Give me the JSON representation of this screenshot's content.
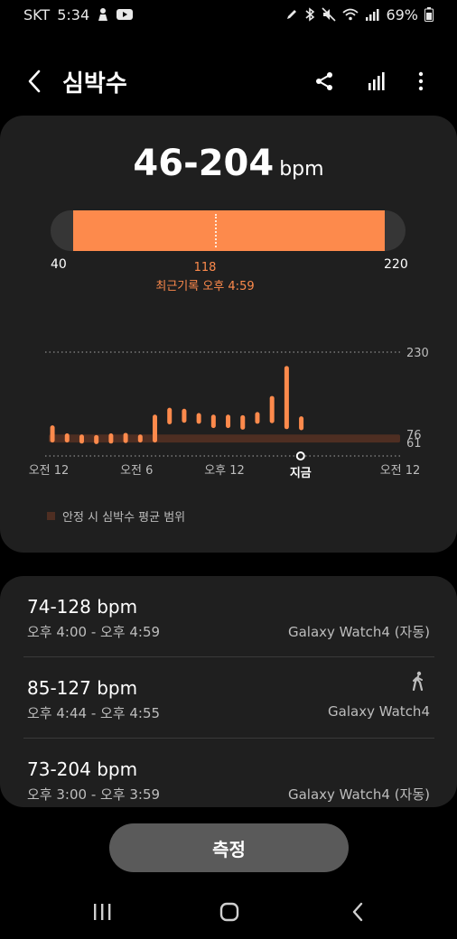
{
  "status_bar": {
    "carrier": "SKT",
    "time": "5:34",
    "battery": "69%",
    "icons": [
      "person-notification-icon",
      "youtube-icon",
      "pen-icon",
      "bluetooth-icon",
      "mute-icon",
      "wifi-icon",
      "signal-icon",
      "battery-icon"
    ]
  },
  "header": {
    "title": "심박수",
    "actions": [
      "share-icon",
      "chart-icon",
      "more-icon"
    ]
  },
  "summary": {
    "range": "46-204",
    "unit": "bpm",
    "scale_min": "40",
    "scale_max": "220",
    "current_value": "118",
    "current_label": "최근기록 오후 4:59",
    "fill_from_bpm": 46,
    "fill_to_bpm": 204,
    "marker_bpm": 118
  },
  "chart_data": {
    "type": "bar",
    "y_ticks": [
      "230",
      "76",
      "61"
    ],
    "x_ticks": [
      "오전 12",
      "오전 6",
      "오후 12",
      "지금",
      "오전 12"
    ],
    "resting_range": [
      61,
      76
    ],
    "ylim": [
      46,
      230
    ],
    "bars": [
      {
        "hour": 0,
        "min": 61,
        "max": 93
      },
      {
        "hour": 1,
        "min": 61,
        "max": 78
      },
      {
        "hour": 2,
        "min": 59,
        "max": 76
      },
      {
        "hour": 3,
        "min": 58,
        "max": 75
      },
      {
        "hour": 4,
        "min": 59,
        "max": 78
      },
      {
        "hour": 5,
        "min": 60,
        "max": 79
      },
      {
        "hour": 6,
        "min": 61,
        "max": 76
      },
      {
        "hour": 7,
        "min": 61,
        "max": 113
      },
      {
        "hour": 8,
        "min": 95,
        "max": 126
      },
      {
        "hour": 9,
        "min": 98,
        "max": 124
      },
      {
        "hour": 10,
        "min": 96,
        "max": 116
      },
      {
        "hour": 11,
        "min": 88,
        "max": 113
      },
      {
        "hour": 12,
        "min": 88,
        "max": 113
      },
      {
        "hour": 13,
        "min": 85,
        "max": 112
      },
      {
        "hour": 14,
        "min": 96,
        "max": 118
      },
      {
        "hour": 15,
        "min": 97,
        "max": 148
      },
      {
        "hour": 16,
        "min": 86,
        "max": 204
      },
      {
        "hour": 17,
        "min": 84,
        "max": 110
      }
    ],
    "legend": "안정 시 심박수 평균 범위"
  },
  "records": [
    {
      "range": "74-128 bpm",
      "time": "오후 4:00 - 오후 4:59",
      "source": "Galaxy Watch4 (자동)",
      "icon": ""
    },
    {
      "range": "85-127 bpm",
      "time": "오후 4:44 - 오후 4:55",
      "source": "Galaxy Watch4",
      "icon": "walking-icon"
    },
    {
      "range": "73-204 bpm",
      "time": "오후 3:00 - 오후 3:59",
      "source": "Galaxy Watch4 (자동)",
      "icon": ""
    }
  ],
  "measure_button": "측정",
  "colors": {
    "accent": "#fd8a4c",
    "resting_band": "#4e2e22",
    "card": "#1f1f1f",
    "background": "#000000"
  }
}
